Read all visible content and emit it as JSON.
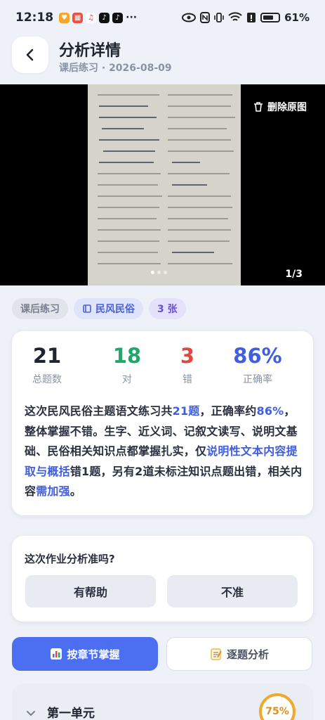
{
  "status_bar": {
    "time": "12:18",
    "battery": "61%"
  },
  "header": {
    "title": "分析详情",
    "subtitle": "课后练习 · 2026-08-09"
  },
  "photo": {
    "delete_label": "删除原图",
    "counter": "1/3"
  },
  "tags": [
    {
      "label": "课后练习"
    },
    {
      "label": "民风民俗"
    },
    {
      "label": "3 张"
    }
  ],
  "stats": [
    {
      "value": "21",
      "label": "总题数",
      "color": "#1f2530"
    },
    {
      "value": "18",
      "label": "对",
      "color": "#1fa86a"
    },
    {
      "value": "3",
      "label": "错",
      "color": "#e0473f"
    },
    {
      "value": "86%",
      "label": "正确率",
      "color": "#3f5ee0"
    }
  ],
  "summary": {
    "p1": "这次民风民俗主题语文练习共",
    "h1": "21题",
    "p2": "，正确率约",
    "h2": "86%",
    "p3": "，整体掌握不错。生字、近义词、记叙文读写、说明文基础、民俗相关知识点都掌握扎实，仅",
    "h3": "说明性文本内容提取与概括",
    "p4": "错1题，另有2道未标注知识点题出错，相关内容",
    "h4": "需加强",
    "p5": "。"
  },
  "feedback": {
    "question": "这次作业分析准吗?",
    "helpful": "有帮助",
    "inaccurate": "不准"
  },
  "tabs": {
    "by_chapter": "按章节掌握",
    "by_question": "逐题分析"
  },
  "section": {
    "name": "第一单元",
    "percent": "75%"
  }
}
